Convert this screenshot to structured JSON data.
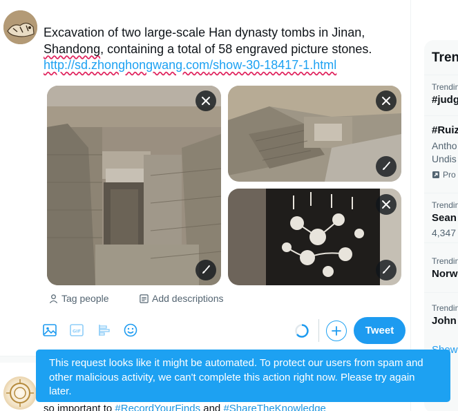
{
  "composer": {
    "text_main": "Excavation of two large-scale Han dynasty tombs in Jinan, ",
    "text_misspelled": "Shandong",
    "text_after": ", containing a total of 58 engraved picture stones.",
    "link_prefix": "http://",
    "link_domain": "sd.zhonghongwang.com",
    "link_path": "/show-30-18417-1.html",
    "media": [
      {
        "alt": "Excavated brick tomb chamber with carved doorway"
      },
      {
        "alt": "Excavation site with stone tomb structure"
      },
      {
        "alt": "Rubbing of engraved picture stone with floral pattern"
      }
    ],
    "tag_people_label": "Tag people",
    "add_descriptions_label": "Add descriptions",
    "toolbar": {
      "icons": [
        "image-icon",
        "gif-icon",
        "poll-icon",
        "emoji-icon"
      ],
      "gif_label": "GIF",
      "tweet_label": "Tweet"
    }
  },
  "feed": {
    "text_prefix": "so important to ",
    "hashtag_1": "#RecordYourFinds",
    "text_middle": " and ",
    "hashtag_2": "#ShareTheKnowledge"
  },
  "trends": {
    "title": "Tren",
    "items": [
      {
        "meta": "Trendin",
        "name": "#judg"
      },
      {
        "name": "#Ruiz",
        "desc_1": "Antho",
        "desc_2": "Undis",
        "promo": "Pro"
      },
      {
        "meta": "Trendin",
        "name": "Sean",
        "count": "4,347"
      },
      {
        "meta": "Trendin",
        "name": "Norw"
      },
      {
        "meta": "Trendin",
        "name": "John"
      }
    ],
    "show_more": "Show"
  },
  "toast": {
    "message": "This request looks like it might be automated. To protect our users from spam and other malicious activity, we can't complete this action right now. Please try again later."
  },
  "colors": {
    "accent": "#1d9bf0",
    "toast_bg": "#1da1f2",
    "text_primary": "#0f1419",
    "text_secondary": "#536471"
  }
}
